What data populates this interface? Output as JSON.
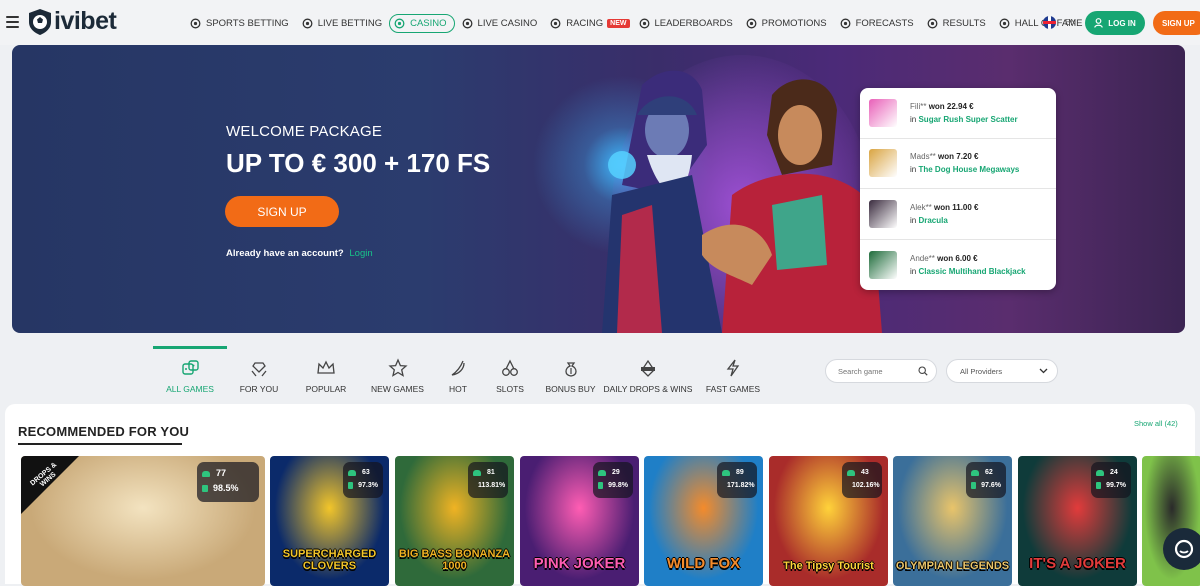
{
  "header": {
    "brand": "ivibet",
    "nav": [
      {
        "label": "SPORTS BETTING",
        "icon": "soccer-ball-icon"
      },
      {
        "label": "LIVE BETTING",
        "icon": "live-ball-icon"
      },
      {
        "label": "CASINO",
        "icon": "casino-chip-icon",
        "active": true
      },
      {
        "label": "LIVE CASINO",
        "icon": "cards-icon"
      },
      {
        "label": "RACING",
        "icon": "horse-icon",
        "badge": "NEW"
      },
      {
        "label": "LEADERBOARDS",
        "icon": "laurel-icon"
      },
      {
        "label": "PROMOTIONS",
        "icon": "gift-icon"
      },
      {
        "label": "FORECASTS",
        "icon": "forecast-icon"
      },
      {
        "label": "RESULTS",
        "icon": "crossed-icon"
      },
      {
        "label": "HALL OF FAME",
        "icon": "trophy-person-icon"
      }
    ],
    "lang": "EN",
    "login_label": "LOG IN",
    "signup_label": "SIGN UP"
  },
  "banner": {
    "welcome": "WELCOME PACKAGE",
    "offer": "UP TO € 300 + 170 FS",
    "signup_label": "SIGN UP",
    "already": "Already have an account?",
    "login_link": "Login",
    "winners": [
      {
        "name": "Fili**",
        "won": "won 22.94 €",
        "in": "in",
        "game": "Sugar Rush Super Scatter",
        "color": "#e85fb8"
      },
      {
        "name": "Mads**",
        "won": "won 7.20 €",
        "in": "in",
        "game": "The Dog House Megaways",
        "color": "#d9a441"
      },
      {
        "name": "Alek**",
        "won": "won 11.00 €",
        "in": "in",
        "game": "Dracula",
        "color": "#3a2b3e"
      },
      {
        "name": "Ande**",
        "won": "won 6.00 €",
        "in": "in",
        "game": "Classic Multihand Blackjack",
        "color": "#1e6b3a"
      }
    ]
  },
  "categories": [
    {
      "label": "ALL GAMES",
      "icon": "dice-icon",
      "active": true
    },
    {
      "label": "FOR YOU",
      "icon": "diamond-hands-icon"
    },
    {
      "label": "POPULAR",
      "icon": "crown-icon"
    },
    {
      "label": "NEW GAMES",
      "icon": "star-icon"
    },
    {
      "label": "HOT",
      "icon": "chili-icon"
    },
    {
      "label": "SLOTS",
      "icon": "cherries-icon"
    },
    {
      "label": "BONUS BUY",
      "icon": "money-bag-icon"
    },
    {
      "label": "DAILY DROPS & WINS",
      "icon": "drops-wins-icon"
    },
    {
      "label": "FAST GAMES",
      "icon": "lightning-icon"
    }
  ],
  "search": {
    "placeholder": "Search game"
  },
  "providers": {
    "selected": "All Providers"
  },
  "section": {
    "title": "RECOMMENDED FOR YOU",
    "show_all": "Show all",
    "count": "(42)"
  },
  "games": [
    {
      "title": "",
      "players": "77",
      "rtp": "98.5%",
      "bg": "#c9a978",
      "accent": "#f3e3c0",
      "ribbon": "DROPS & WINS"
    },
    {
      "title": "SUPERCHARGED CLOVERS",
      "players": "63",
      "rtp": "97.3%",
      "bg": "#0b2a6a",
      "accent": "#f2c52a"
    },
    {
      "title": "BIG BASS BONANZA 1000",
      "players": "81",
      "rtp": "113.81%",
      "bg": "#2f6a3a",
      "accent": "#f0b323"
    },
    {
      "title": "PINK JOKER",
      "players": "29",
      "rtp": "99.8%",
      "bg": "#4a1e72",
      "accent": "#ff5db3"
    },
    {
      "title": "WILD FOX",
      "players": "89",
      "rtp": "171.82%",
      "bg": "#1f7fc7",
      "accent": "#f48b2b"
    },
    {
      "title": "The Tipsy Tourist",
      "players": "43",
      "rtp": "102.16%",
      "bg": "#a92c2a",
      "accent": "#ffd23a"
    },
    {
      "title": "OLYMPIAN LEGENDS",
      "players": "62",
      "rtp": "97.6%",
      "bg": "#3b6f9a",
      "accent": "#e9c46a"
    },
    {
      "title": "IT'S A JOKER",
      "players": "24",
      "rtp": "99.7%",
      "bg": "#0f3b3a",
      "accent": "#e23b3b"
    },
    {
      "title": "",
      "players": "",
      "rtp": "",
      "bg": "#7fc24a",
      "accent": "#2a2a2a"
    }
  ]
}
